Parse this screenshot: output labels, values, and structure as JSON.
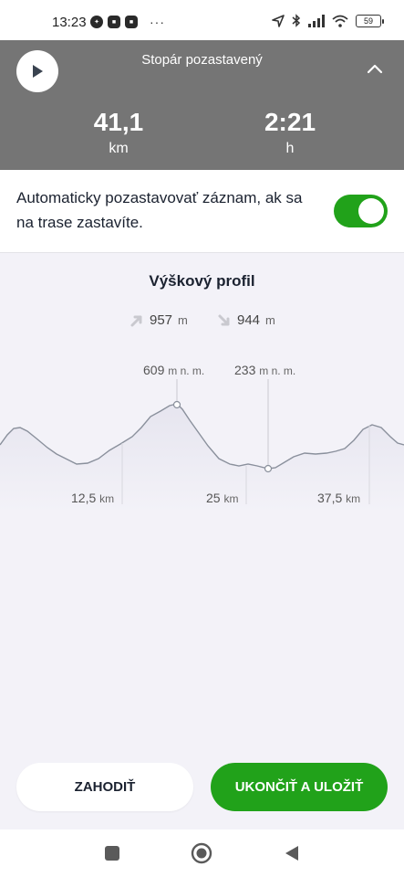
{
  "status_bar": {
    "time": "13:23",
    "battery": "59"
  },
  "panel": {
    "title": "Stopár pozastavený",
    "distance": {
      "value": "41,1",
      "unit": "km"
    },
    "duration": {
      "value": "2:21",
      "unit": "h"
    }
  },
  "auto_pause": {
    "text": "Automaticky pozastavovať záznam, ak sa na trase zastavíte.",
    "enabled": true
  },
  "profile": {
    "title": "Výškový profil",
    "ascent": {
      "value": "957",
      "unit": "m"
    },
    "descent": {
      "value": "944",
      "unit": "m"
    },
    "max_label": {
      "value": "609",
      "unit": "m n. m."
    },
    "min_label": {
      "value": "233",
      "unit": "m n. m."
    },
    "distance_markers": [
      {
        "value": "12,5",
        "unit": "km"
      },
      {
        "value": "25",
        "unit": "km"
      },
      {
        "value": "37,5",
        "unit": "km"
      }
    ]
  },
  "actions": {
    "discard_label": "ZAHODIŤ",
    "save_label": "UKONČIŤ A ULOŽIŤ"
  },
  "colors": {
    "accent": "#21a21a",
    "panel": "#757575"
  }
}
